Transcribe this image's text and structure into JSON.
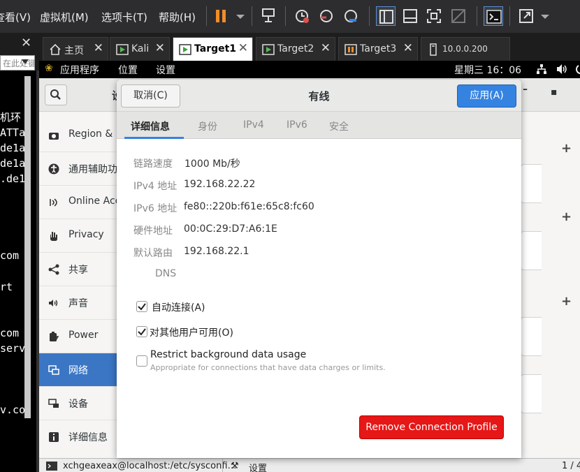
{
  "vmware_menu": {
    "view": "查看(V)",
    "vm": "虚拟机(M)",
    "tabs": "选项卡(T)",
    "help": "帮助(H)"
  },
  "tabs": [
    {
      "label": "主页"
    },
    {
      "label": "Kali"
    },
    {
      "label": "Target1"
    },
    {
      "label": "Target2"
    },
    {
      "label": "Target3"
    },
    {
      "label": "10.0.0.200"
    }
  ],
  "library_search": {
    "placeholder": "在此处键入内容进行搜索"
  },
  "terminal": {
    "lines": [
      "机环",
      "ATTa",
      "de1a",
      "de1a",
      ".de1",
      "com",
      "rt",
      "com",
      "serv",
      "v.co"
    ]
  },
  "gnome_topbar": {
    "applications": "应用程序",
    "places": "位置",
    "settings": "设置",
    "clock": "星期三 16：06"
  },
  "settings_sidebar": [
    {
      "label": "Region & L"
    },
    {
      "label": "通用辅助功"
    },
    {
      "label": "Online Acc"
    },
    {
      "label": "Privacy"
    },
    {
      "label": "共享"
    },
    {
      "label": "声音"
    },
    {
      "label": "Power"
    },
    {
      "label": "网络"
    },
    {
      "label": "设备"
    },
    {
      "label": "详细信息"
    }
  ],
  "settings_header": {
    "title_fragment": "设"
  },
  "dialog": {
    "title": "有线",
    "cancel": "取消(C)",
    "apply": "应用(A)",
    "tabs": [
      "详细信息",
      "身份",
      "IPv4",
      "IPv6",
      "安全"
    ],
    "info": [
      {
        "label": "链路速度",
        "value": "1000 Mb/秒"
      },
      {
        "label": "IPv4 地址",
        "value": "192.168.22.22"
      },
      {
        "label": "IPv6 地址",
        "value": "fe80::220b:f61e:65c8:fc60"
      },
      {
        "label": "硬件地址",
        "value": "00:0C:29:D7:A6:1E"
      },
      {
        "label": "默认路由",
        "value": "192.168.22.1"
      },
      {
        "label": "DNS",
        "value": ""
      }
    ],
    "auto_connect": {
      "label": "自动连接(A)",
      "checked": true
    },
    "all_users": {
      "label": "对其他用户可用(O)",
      "checked": true
    },
    "restrict_bg": {
      "label": "Restrict background data usage",
      "sublabel": "Appropriate for connections that have data charges or limits.",
      "checked": false
    },
    "remove": "Remove Connection Profile"
  },
  "statusbar": {
    "terminal_task": "xchgeaxeax@localhost:/etc/sysconfi…",
    "settings_task": "设置",
    "workspace": "1 / 4"
  },
  "colors": {
    "accent": "#3583e1",
    "danger": "#e61717",
    "sidebar_selected": "#3b76c4",
    "vm_pause": "#f28c28"
  }
}
